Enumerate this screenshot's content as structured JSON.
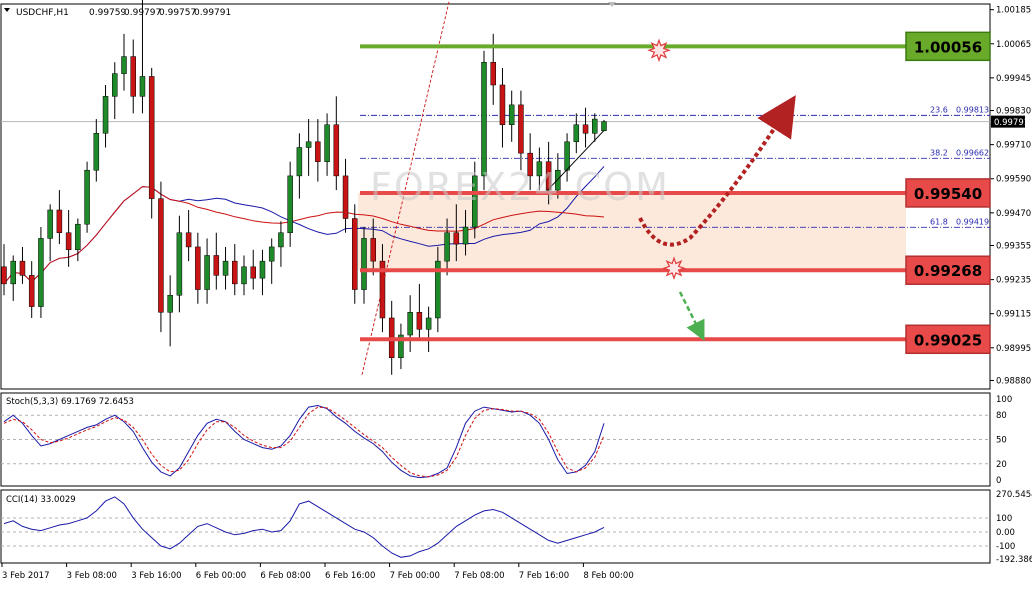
{
  "chart_data": {
    "type": "candlestick",
    "symbol_header": {
      "symbol": "USDCHF,H1",
      "open": "0.99759",
      "high": "0.99797",
      "low": "0.99757",
      "close": "0.99791"
    },
    "price_axis": {
      "ylim": [
        0.9885,
        1.00205
      ],
      "ticks": [
        "1.00185",
        "1.00065",
        "0.99945",
        "0.99830",
        "0.99710",
        "0.99590",
        "0.99470",
        "0.99355",
        "0.99235",
        "0.99115",
        "0.98995",
        "0.98880"
      ]
    },
    "current_price": "0.99791",
    "x_tick_labels": [
      "3 Feb 2017",
      "3 Feb 08:00",
      "3 Feb 16:00",
      "6 Feb 00:00",
      "6 Feb 08:00",
      "6 Feb 16:00",
      "7 Feb 00:00",
      "7 Feb 08:00",
      "7 Feb 16:00",
      "8 Feb 00:00"
    ],
    "levels": [
      {
        "label": "1.00056",
        "value": 1.00056,
        "color": "#6aaa2a"
      },
      {
        "label": "0.99540",
        "value": 0.9954,
        "color": "#e84a4a"
      },
      {
        "label": "0.99268",
        "value": 0.99268,
        "color": "#e84a4a"
      },
      {
        "label": "0.99025",
        "value": 0.99025,
        "color": "#e84a4a"
      }
    ],
    "fibonacci": [
      {
        "ratio": "23.6",
        "price": "0.99813",
        "value": 0.99813
      },
      {
        "ratio": "38.2",
        "price": "0.99662",
        "value": 0.99662
      },
      {
        "ratio": "61.8",
        "price": "0.99419",
        "value": 0.99419
      }
    ],
    "watermark": "FOREX24.COM",
    "candles": [
      [
        0.9928,
        0.9936,
        0.9918,
        0.9922
      ],
      [
        0.9922,
        0.9932,
        0.9916,
        0.993
      ],
      [
        0.993,
        0.9935,
        0.9922,
        0.9925
      ],
      [
        0.9925,
        0.993,
        0.991,
        0.9914
      ],
      [
        0.9914,
        0.9942,
        0.991,
        0.9938
      ],
      [
        0.9938,
        0.995,
        0.993,
        0.9948
      ],
      [
        0.9948,
        0.9955,
        0.9936,
        0.994
      ],
      [
        0.994,
        0.9948,
        0.9928,
        0.9934
      ],
      [
        0.9934,
        0.9945,
        0.993,
        0.9943
      ],
      [
        0.9943,
        0.9965,
        0.994,
        0.9962
      ],
      [
        0.9962,
        0.998,
        0.9958,
        0.9975
      ],
      [
        0.9975,
        0.9992,
        0.997,
        0.9988
      ],
      [
        0.9988,
        1.0,
        0.998,
        0.9996
      ],
      [
        0.9996,
        1.001,
        0.999,
        1.0002
      ],
      [
        1.0002,
        1.0008,
        0.9982,
        0.9988
      ],
      [
        0.9988,
        1.0045,
        0.9982,
        0.9995
      ],
      [
        0.9995,
        0.9998,
        0.9945,
        0.9952
      ],
      [
        0.9952,
        0.9958,
        0.9905,
        0.9912
      ],
      [
        0.9912,
        0.9925,
        0.99,
        0.9918
      ],
      [
        0.9918,
        0.9946,
        0.9912,
        0.994
      ],
      [
        0.994,
        0.9948,
        0.993,
        0.9935
      ],
      [
        0.9935,
        0.994,
        0.9915,
        0.992
      ],
      [
        0.992,
        0.9938,
        0.9915,
        0.9932
      ],
      [
        0.9932,
        0.994,
        0.992,
        0.9925
      ],
      [
        0.9925,
        0.9935,
        0.992,
        0.993
      ],
      [
        0.993,
        0.9936,
        0.9918,
        0.9922
      ],
      [
        0.9922,
        0.9932,
        0.9918,
        0.9928
      ],
      [
        0.9928,
        0.9934,
        0.992,
        0.9924
      ],
      [
        0.9924,
        0.9934,
        0.9918,
        0.993
      ],
      [
        0.993,
        0.9938,
        0.9922,
        0.9935
      ],
      [
        0.9935,
        0.9944,
        0.9928,
        0.994
      ],
      [
        0.994,
        0.9965,
        0.9935,
        0.996
      ],
      [
        0.996,
        0.9975,
        0.9952,
        0.997
      ],
      [
        0.997,
        0.998,
        0.996,
        0.9972
      ],
      [
        0.9972,
        0.998,
        0.9958,
        0.9965
      ],
      [
        0.9965,
        0.9982,
        0.996,
        0.9978
      ],
      [
        0.9978,
        0.9988,
        0.9955,
        0.996
      ],
      [
        0.996,
        0.9966,
        0.994,
        0.9945
      ],
      [
        0.9945,
        0.995,
        0.9915,
        0.992
      ],
      [
        0.992,
        0.9942,
        0.9915,
        0.9938
      ],
      [
        0.9938,
        0.9945,
        0.9925,
        0.993
      ],
      [
        0.993,
        0.9936,
        0.9905,
        0.991
      ],
      [
        0.991,
        0.9916,
        0.989,
        0.9896
      ],
      [
        0.9896,
        0.9908,
        0.9892,
        0.9904
      ],
      [
        0.9904,
        0.9918,
        0.9898,
        0.9912
      ],
      [
        0.9912,
        0.9922,
        0.9902,
        0.9906
      ],
      [
        0.9906,
        0.9914,
        0.9898,
        0.991
      ],
      [
        0.991,
        0.9935,
        0.9905,
        0.993
      ],
      [
        0.993,
        0.9945,
        0.9925,
        0.994
      ],
      [
        0.994,
        0.995,
        0.993,
        0.9936
      ],
      [
        0.9936,
        0.9948,
        0.9932,
        0.9942
      ],
      [
        0.9942,
        0.9965,
        0.9938,
        0.996
      ],
      [
        0.996,
        1.0004,
        0.9955,
        1.0
      ],
      [
        1.0,
        1.001,
        0.9985,
        0.9992
      ],
      [
        0.9992,
        0.9998,
        0.997,
        0.9978
      ],
      [
        0.9978,
        0.999,
        0.9972,
        0.9985
      ],
      [
        0.9985,
        0.999,
        0.9962,
        0.9968
      ],
      [
        0.9968,
        0.9975,
        0.9955,
        0.996
      ],
      [
        0.996,
        0.997,
        0.9955,
        0.9965
      ],
      [
        0.9965,
        0.9972,
        0.995,
        0.9955
      ],
      [
        0.9955,
        0.9968,
        0.9952,
        0.9962
      ],
      [
        0.9962,
        0.9975,
        0.9958,
        0.9972
      ],
      [
        0.9972,
        0.9982,
        0.9968,
        0.9978
      ],
      [
        0.9978,
        0.9984,
        0.997,
        0.9975
      ],
      [
        0.9975,
        0.9982,
        0.9972,
        0.998
      ],
      [
        0.99759,
        0.99797,
        0.99757,
        0.99791
      ]
    ],
    "stochastic": {
      "label": "Stoch(5,3,3) 69.1769 72.6453",
      "ticks": [
        "100",
        "80",
        "50",
        "20",
        "0"
      ],
      "main": [
        72,
        80,
        70,
        55,
        42,
        45,
        50,
        55,
        60,
        65,
        68,
        75,
        80,
        72,
        60,
        40,
        22,
        10,
        5,
        15,
        35,
        55,
        70,
        75,
        72,
        60,
        50,
        45,
        40,
        38,
        42,
        55,
        75,
        90,
        92,
        88,
        78,
        70,
        60,
        52,
        45,
        35,
        22,
        12,
        5,
        3,
        4,
        8,
        15,
        40,
        70,
        85,
        90,
        88,
        86,
        84,
        85,
        80,
        70,
        50,
        25,
        8,
        10,
        18,
        35,
        70
      ],
      "signal": [
        70,
        75,
        72,
        62,
        50,
        46,
        48,
        52,
        57,
        62,
        66,
        72,
        77,
        74,
        65,
        50,
        32,
        18,
        10,
        12,
        25,
        45,
        62,
        72,
        72,
        65,
        55,
        48,
        43,
        40,
        40,
        48,
        65,
        82,
        90,
        89,
        82,
        74,
        65,
        56,
        48,
        40,
        28,
        18,
        9,
        5,
        4,
        6,
        12,
        28,
        55,
        76,
        86,
        88,
        87,
        85,
        85,
        82,
        75,
        58,
        35,
        15,
        10,
        15,
        28,
        55
      ]
    },
    "cci": {
      "label": "CCI(14) 33.0029",
      "ticks": [
        "270.5454",
        "100",
        "0.00",
        "-100",
        "-192.3862"
      ],
      "values": [
        60,
        80,
        40,
        20,
        10,
        30,
        50,
        60,
        80,
        100,
        150,
        220,
        250,
        200,
        100,
        20,
        -40,
        -100,
        -120,
        -80,
        -20,
        40,
        60,
        30,
        0,
        -20,
        -10,
        10,
        20,
        0,
        10,
        80,
        200,
        220,
        180,
        140,
        100,
        60,
        20,
        0,
        -40,
        -100,
        -150,
        -180,
        -170,
        -140,
        -120,
        -80,
        -20,
        40,
        80,
        120,
        150,
        160,
        140,
        100,
        60,
        20,
        -20,
        -60,
        -80,
        -60,
        -40,
        -20,
        0,
        33
      ]
    }
  }
}
